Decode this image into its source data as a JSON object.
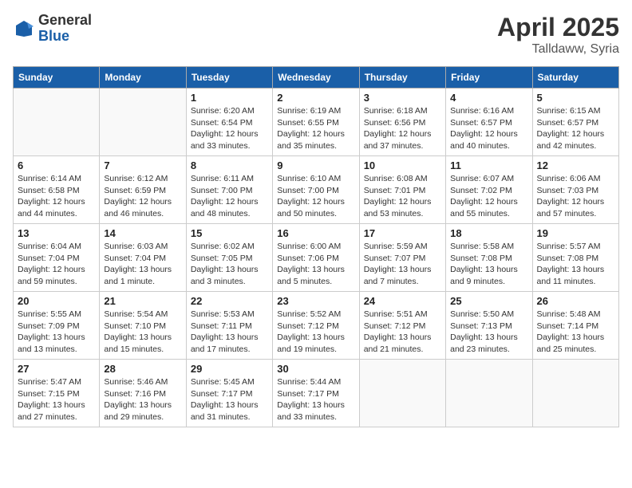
{
  "header": {
    "logo_general": "General",
    "logo_blue": "Blue",
    "month": "April 2025",
    "location": "Talldaww, Syria"
  },
  "weekdays": [
    "Sunday",
    "Monday",
    "Tuesday",
    "Wednesday",
    "Thursday",
    "Friday",
    "Saturday"
  ],
  "weeks": [
    [
      {
        "day": "",
        "info": ""
      },
      {
        "day": "",
        "info": ""
      },
      {
        "day": "1",
        "info": "Sunrise: 6:20 AM\nSunset: 6:54 PM\nDaylight: 12 hours\nand 33 minutes."
      },
      {
        "day": "2",
        "info": "Sunrise: 6:19 AM\nSunset: 6:55 PM\nDaylight: 12 hours\nand 35 minutes."
      },
      {
        "day": "3",
        "info": "Sunrise: 6:18 AM\nSunset: 6:56 PM\nDaylight: 12 hours\nand 37 minutes."
      },
      {
        "day": "4",
        "info": "Sunrise: 6:16 AM\nSunset: 6:57 PM\nDaylight: 12 hours\nand 40 minutes."
      },
      {
        "day": "5",
        "info": "Sunrise: 6:15 AM\nSunset: 6:57 PM\nDaylight: 12 hours\nand 42 minutes."
      }
    ],
    [
      {
        "day": "6",
        "info": "Sunrise: 6:14 AM\nSunset: 6:58 PM\nDaylight: 12 hours\nand 44 minutes."
      },
      {
        "day": "7",
        "info": "Sunrise: 6:12 AM\nSunset: 6:59 PM\nDaylight: 12 hours\nand 46 minutes."
      },
      {
        "day": "8",
        "info": "Sunrise: 6:11 AM\nSunset: 7:00 PM\nDaylight: 12 hours\nand 48 minutes."
      },
      {
        "day": "9",
        "info": "Sunrise: 6:10 AM\nSunset: 7:00 PM\nDaylight: 12 hours\nand 50 minutes."
      },
      {
        "day": "10",
        "info": "Sunrise: 6:08 AM\nSunset: 7:01 PM\nDaylight: 12 hours\nand 53 minutes."
      },
      {
        "day": "11",
        "info": "Sunrise: 6:07 AM\nSunset: 7:02 PM\nDaylight: 12 hours\nand 55 minutes."
      },
      {
        "day": "12",
        "info": "Sunrise: 6:06 AM\nSunset: 7:03 PM\nDaylight: 12 hours\nand 57 minutes."
      }
    ],
    [
      {
        "day": "13",
        "info": "Sunrise: 6:04 AM\nSunset: 7:04 PM\nDaylight: 12 hours\nand 59 minutes."
      },
      {
        "day": "14",
        "info": "Sunrise: 6:03 AM\nSunset: 7:04 PM\nDaylight: 13 hours\nand 1 minute."
      },
      {
        "day": "15",
        "info": "Sunrise: 6:02 AM\nSunset: 7:05 PM\nDaylight: 13 hours\nand 3 minutes."
      },
      {
        "day": "16",
        "info": "Sunrise: 6:00 AM\nSunset: 7:06 PM\nDaylight: 13 hours\nand 5 minutes."
      },
      {
        "day": "17",
        "info": "Sunrise: 5:59 AM\nSunset: 7:07 PM\nDaylight: 13 hours\nand 7 minutes."
      },
      {
        "day": "18",
        "info": "Sunrise: 5:58 AM\nSunset: 7:08 PM\nDaylight: 13 hours\nand 9 minutes."
      },
      {
        "day": "19",
        "info": "Sunrise: 5:57 AM\nSunset: 7:08 PM\nDaylight: 13 hours\nand 11 minutes."
      }
    ],
    [
      {
        "day": "20",
        "info": "Sunrise: 5:55 AM\nSunset: 7:09 PM\nDaylight: 13 hours\nand 13 minutes."
      },
      {
        "day": "21",
        "info": "Sunrise: 5:54 AM\nSunset: 7:10 PM\nDaylight: 13 hours\nand 15 minutes."
      },
      {
        "day": "22",
        "info": "Sunrise: 5:53 AM\nSunset: 7:11 PM\nDaylight: 13 hours\nand 17 minutes."
      },
      {
        "day": "23",
        "info": "Sunrise: 5:52 AM\nSunset: 7:12 PM\nDaylight: 13 hours\nand 19 minutes."
      },
      {
        "day": "24",
        "info": "Sunrise: 5:51 AM\nSunset: 7:12 PM\nDaylight: 13 hours\nand 21 minutes."
      },
      {
        "day": "25",
        "info": "Sunrise: 5:50 AM\nSunset: 7:13 PM\nDaylight: 13 hours\nand 23 minutes."
      },
      {
        "day": "26",
        "info": "Sunrise: 5:48 AM\nSunset: 7:14 PM\nDaylight: 13 hours\nand 25 minutes."
      }
    ],
    [
      {
        "day": "27",
        "info": "Sunrise: 5:47 AM\nSunset: 7:15 PM\nDaylight: 13 hours\nand 27 minutes."
      },
      {
        "day": "28",
        "info": "Sunrise: 5:46 AM\nSunset: 7:16 PM\nDaylight: 13 hours\nand 29 minutes."
      },
      {
        "day": "29",
        "info": "Sunrise: 5:45 AM\nSunset: 7:17 PM\nDaylight: 13 hours\nand 31 minutes."
      },
      {
        "day": "30",
        "info": "Sunrise: 5:44 AM\nSunset: 7:17 PM\nDaylight: 13 hours\nand 33 minutes."
      },
      {
        "day": "",
        "info": ""
      },
      {
        "day": "",
        "info": ""
      },
      {
        "day": "",
        "info": ""
      }
    ]
  ]
}
